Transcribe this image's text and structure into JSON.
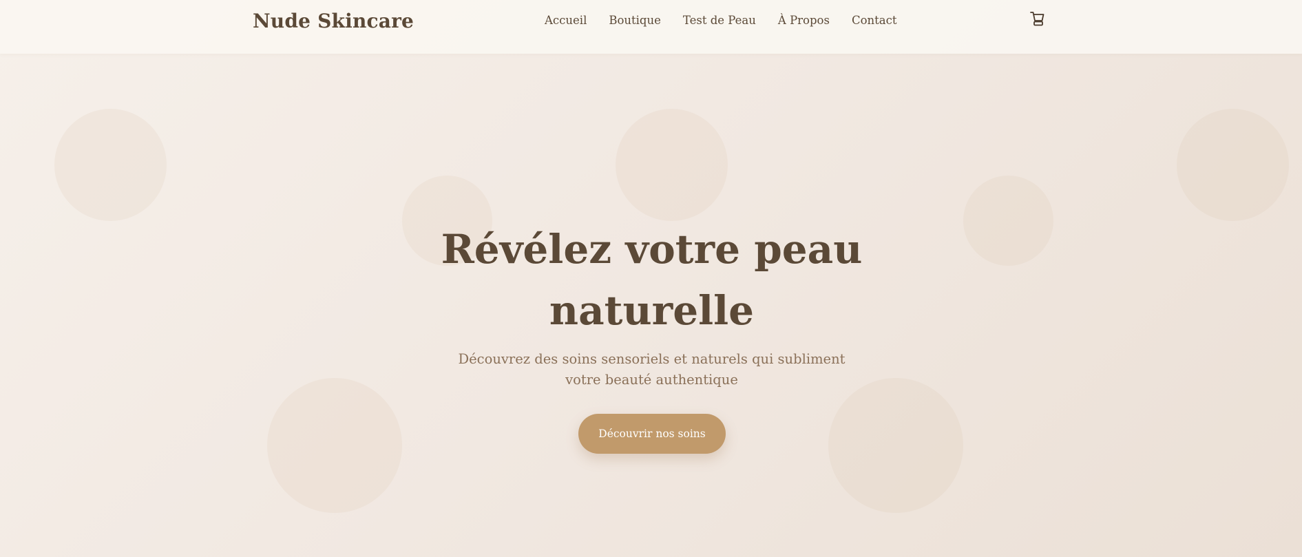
{
  "header": {
    "brand": "Nude Skincare",
    "nav": [
      "Accueil",
      "Boutique",
      "Test de Peau",
      "À Propos",
      "Contact"
    ],
    "cart_icon": "shopping-cart-icon"
  },
  "hero": {
    "title": "Révélez votre peau naturelle",
    "subtitle": "Découvrez des soins sensoriels et naturels qui subliment votre beauté authentique",
    "cta_label": "Découvrir nos soins"
  },
  "colors": {
    "brand_text": "#5b4937",
    "accent": "#c19a6b",
    "subtitle": "#8a7058",
    "background": "#f1e8e1"
  }
}
